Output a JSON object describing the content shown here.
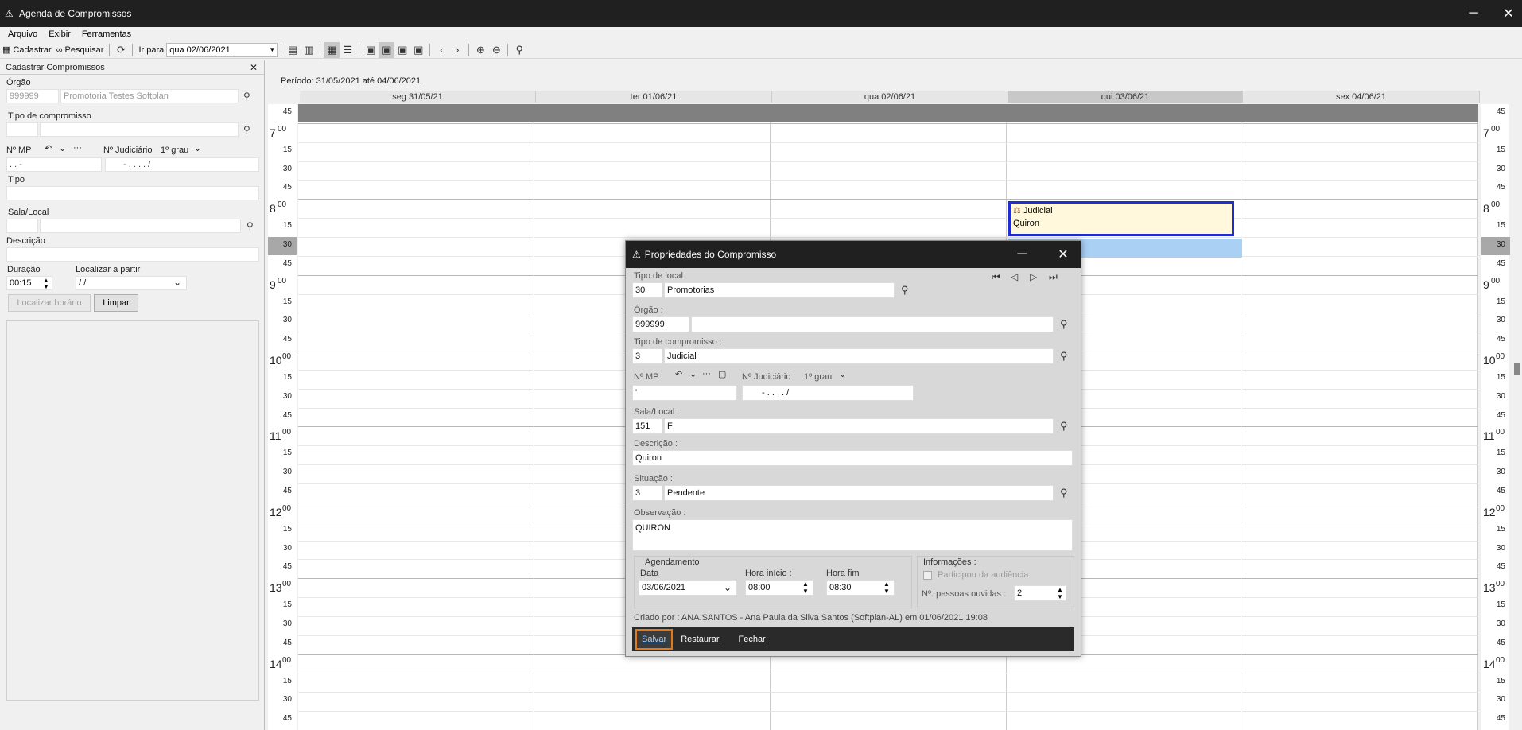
{
  "window": {
    "title": "Agenda de Compromissos",
    "minimize": "─",
    "close": "✕"
  },
  "menu": {
    "items": [
      "Arquivo",
      "Exibir",
      "Ferramentas"
    ]
  },
  "toolbar": {
    "cadastrar": "Cadastrar",
    "pesquisar": "Pesquisar",
    "ir_para": "Ir para",
    "date_value": "qua 02/06/2021"
  },
  "left_panel": {
    "title": "Cadastrar Compromissos",
    "orgao_label": "Órgão",
    "orgao_code": "999999",
    "orgao_name": "Promotoria Testes Softplan",
    "tipo_compromisso_label": "Tipo de compromisso",
    "nmp_label": "Nº MP",
    "njud_label": "Nº Judiciário",
    "grau": "1º grau",
    "nmp_mask": ". . -",
    "njud_mask": "- . . . . /",
    "tipo_label": "Tipo",
    "sala_label": "Sala/Local",
    "descricao_label": "Descrição",
    "duracao_label": "Duração",
    "duracao_value": "00:15",
    "localizar_label": "Localizar a partir",
    "localizar_value": " / /",
    "btn_localizar": "Localizar horário",
    "btn_limpar": "Limpar"
  },
  "calendar": {
    "periodo": "Período: 31/05/2021 até 04/06/2021",
    "days": [
      "seg 31/05/21",
      "ter 01/06/21",
      "qua 02/06/21",
      "qui 03/06/21",
      "sex 04/06/21"
    ],
    "selected_day_index": 3,
    "time_labels": [
      {
        "h": "",
        "m": "45"
      },
      {
        "h": "7",
        "m": "00"
      },
      {
        "h": "",
        "m": "15"
      },
      {
        "h": "",
        "m": "30"
      },
      {
        "h": "",
        "m": "45"
      },
      {
        "h": "8",
        "m": "00"
      },
      {
        "h": "",
        "m": "15"
      },
      {
        "h": "",
        "m": "30"
      },
      {
        "h": "",
        "m": "45"
      },
      {
        "h": "9",
        "m": "00"
      },
      {
        "h": "",
        "m": "15"
      },
      {
        "h": "",
        "m": "30"
      },
      {
        "h": "",
        "m": "45"
      },
      {
        "h": "10",
        "m": "00"
      },
      {
        "h": "",
        "m": "15"
      },
      {
        "h": "",
        "m": "30"
      },
      {
        "h": "",
        "m": "45"
      },
      {
        "h": "11",
        "m": "00"
      },
      {
        "h": "",
        "m": "15"
      },
      {
        "h": "",
        "m": "30"
      },
      {
        "h": "",
        "m": "45"
      },
      {
        "h": "12",
        "m": "00"
      },
      {
        "h": "",
        "m": "15"
      },
      {
        "h": "",
        "m": "30"
      },
      {
        "h": "",
        "m": "45"
      },
      {
        "h": "13",
        "m": "00"
      },
      {
        "h": "",
        "m": "15"
      },
      {
        "h": "",
        "m": "30"
      },
      {
        "h": "",
        "m": "45"
      },
      {
        "h": "14",
        "m": "00"
      },
      {
        "h": "",
        "m": "15"
      },
      {
        "h": "",
        "m": "30"
      },
      {
        "h": "",
        "m": "45"
      }
    ],
    "event": {
      "type": "Judicial",
      "desc": "Quiron"
    }
  },
  "dialog": {
    "title": "Propriedades do Compromisso",
    "tipo_local_label": "Tipo de local",
    "tipo_local_code": "30",
    "tipo_local_name": "Promotorias",
    "orgao_label": "Órgão :",
    "orgao_code": "999999",
    "tipo_comp_label": "Tipo de compromisso :",
    "tipo_comp_code": "3",
    "tipo_comp_name": "Judicial",
    "nmp_label": "Nº MP",
    "njud_label": "Nº Judiciário",
    "grau": "1º grau",
    "nmp_value": "'",
    "njud_value": "- . . . . /",
    "sala_label": "Sala/Local :",
    "sala_code": "151",
    "sala_name": "F",
    "descricao_label": "Descrição :",
    "descricao_value": "Quiron",
    "situacao_label": "Situação :",
    "situacao_code": "3",
    "situacao_name": "Pendente",
    "observacao_label": "Observação :",
    "observacao_value": "QUIRON",
    "agendamento_label": "Agendamento",
    "data_label": "Data",
    "data_value": "03/06/2021",
    "hora_inicio_label": "Hora início :",
    "hora_inicio_value": "08:00",
    "hora_fim_label": "Hora fim",
    "hora_fim_value": "08:30",
    "informacoes_label": "Informações :",
    "participou_label": "Participou da audiência",
    "pessoas_label": "Nº. pessoas ouvidas :",
    "pessoas_value": "2",
    "criado_por": "Criado por : ANA.SANTOS - Ana Paula da Silva Santos (Softplan-AL) em 01/06/2021 19:08",
    "btn_salvar": "Salvar",
    "btn_restaurar": "Restaurar",
    "btn_fechar": "Fechar"
  }
}
